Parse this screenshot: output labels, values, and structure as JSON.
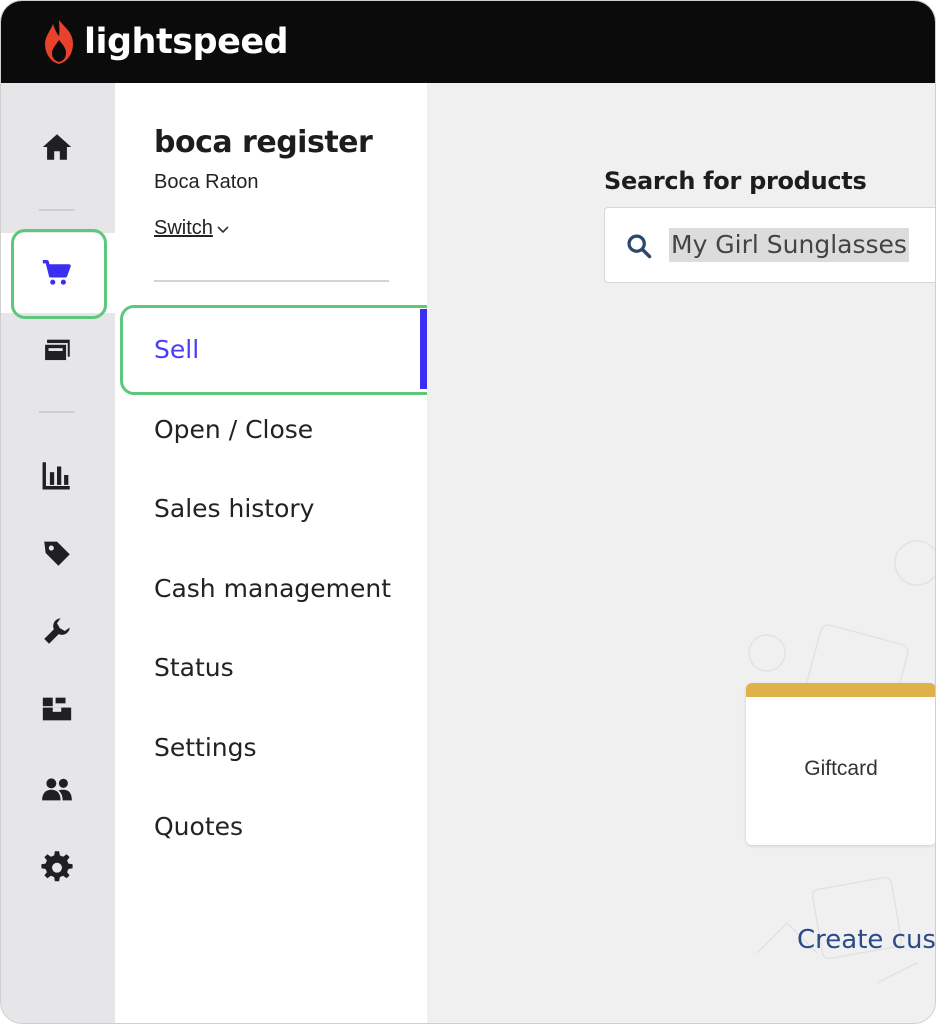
{
  "app": {
    "brand": "lightspeed",
    "brand_color": "#e8412c"
  },
  "rail": {
    "items": [
      {
        "icon": "home-icon"
      },
      {
        "icon": "cart-icon",
        "active": true
      },
      {
        "icon": "register-icon"
      },
      {
        "icon": "reports-icon"
      },
      {
        "icon": "tag-icon"
      },
      {
        "icon": "wrench-icon"
      },
      {
        "icon": "inventory-icon"
      },
      {
        "icon": "customers-icon"
      },
      {
        "icon": "gear-icon"
      }
    ],
    "active_color": "#3a2ff0",
    "highlight_color": "#5dc77a"
  },
  "submenu": {
    "register_name": "boca register",
    "location": "Boca Raton",
    "switch_label": "Switch",
    "items": [
      {
        "label": "Sell",
        "active": true
      },
      {
        "label": "Open / Close"
      },
      {
        "label": "Sales history"
      },
      {
        "label": "Cash management"
      },
      {
        "label": "Status"
      },
      {
        "label": "Settings"
      },
      {
        "label": "Quotes"
      }
    ]
  },
  "main": {
    "search_label": "Search for products",
    "search_value": "My Girl Sunglasses",
    "giftcard_label": "Giftcard",
    "create_link": "Create custo"
  }
}
